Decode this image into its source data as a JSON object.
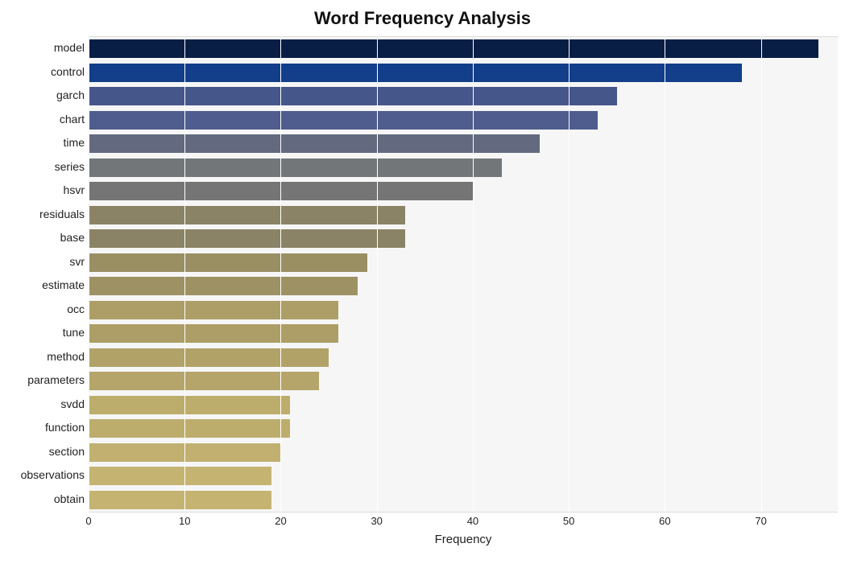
{
  "chart_data": {
    "type": "bar",
    "orientation": "horizontal",
    "title": "Word Frequency Analysis",
    "xlabel": "Frequency",
    "ylabel": "",
    "xlim": [
      0,
      78
    ],
    "x_ticks": [
      0,
      10,
      20,
      30,
      40,
      50,
      60,
      70
    ],
    "categories": [
      "model",
      "control",
      "garch",
      "chart",
      "time",
      "series",
      "hsvr",
      "residuals",
      "base",
      "svr",
      "estimate",
      "occ",
      "tune",
      "method",
      "parameters",
      "svdd",
      "function",
      "section",
      "observations",
      "obtain"
    ],
    "values": [
      76,
      68,
      55,
      53,
      47,
      43,
      40,
      33,
      33,
      29,
      28,
      26,
      26,
      25,
      24,
      21,
      21,
      20,
      19,
      19
    ],
    "colors": [
      "#081e45",
      "#123e8a",
      "#45568a",
      "#4e5d8d",
      "#636a7f",
      "#737679",
      "#757575",
      "#8a8366",
      "#8a8366",
      "#9a8f63",
      "#9e9264",
      "#ac9e66",
      "#ac9e66",
      "#b1a268",
      "#b5a56a",
      "#bdad6d",
      "#bdad6d",
      "#c1b070",
      "#c5b371",
      "#c5b371"
    ]
  }
}
